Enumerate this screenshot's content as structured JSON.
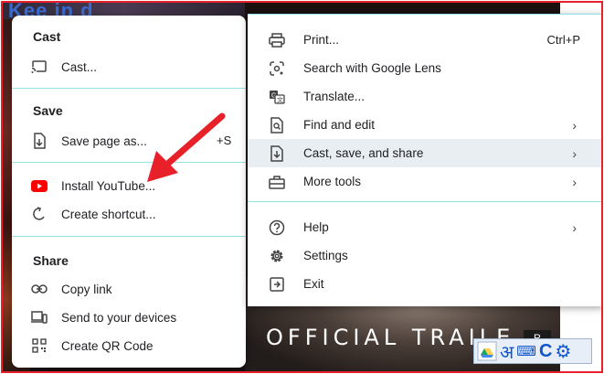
{
  "background": {
    "top_text": "Kee in d",
    "video_caption": "OFFICIAL TRAILE",
    "video_badge": "R"
  },
  "submenu": {
    "sections": {
      "cast": {
        "title": "Cast",
        "items": [
          {
            "label": "Cast...",
            "icon": "cast-icon"
          }
        ]
      },
      "save": {
        "title": "Save",
        "items": [
          {
            "label": "Save page as...",
            "icon": "save-page-icon",
            "shortcut_peek": "+S"
          }
        ]
      },
      "install": {
        "items": [
          {
            "label": "Install YouTube...",
            "icon": "youtube-icon"
          },
          {
            "label": "Create shortcut...",
            "icon": "shortcut-icon"
          }
        ]
      },
      "share": {
        "title": "Share",
        "items": [
          {
            "label": "Copy link",
            "icon": "link-icon"
          },
          {
            "label": "Send to your devices",
            "icon": "devices-icon"
          },
          {
            "label": "Create QR Code",
            "icon": "qr-code-icon"
          }
        ]
      }
    }
  },
  "mainmenu": {
    "items": [
      {
        "label": "Print...",
        "shortcut": "Ctrl+P",
        "icon": "print-icon"
      },
      {
        "label": "Search with Google Lens",
        "icon": "google-lens-icon"
      },
      {
        "label": "Translate...",
        "icon": "translate-icon"
      },
      {
        "label": "Find and edit",
        "icon": "find-icon",
        "submenu": true
      },
      {
        "label": "Cast, save, and share",
        "icon": "cast-save-share-icon",
        "submenu": true,
        "active": true
      },
      {
        "label": "More tools",
        "icon": "toolbox-icon",
        "submenu": true
      },
      {
        "label": "Help",
        "icon": "help-icon",
        "submenu": true
      },
      {
        "label": "Settings",
        "icon": "gear-icon"
      },
      {
        "label": "Exit",
        "icon": "exit-icon"
      }
    ],
    "chevron": "›"
  },
  "input_tools": {
    "hindi_glyph": "अ",
    "c_glyph": "C",
    "keyboard_glyph": "⌨",
    "gear_glyph": "⚙"
  },
  "colors": {
    "frame_border": "#e8202a",
    "separator": "#8fe3e6",
    "youtube_red": "#ff0000",
    "arrow_red": "#e8202a",
    "active_row": "#e9eef3"
  }
}
